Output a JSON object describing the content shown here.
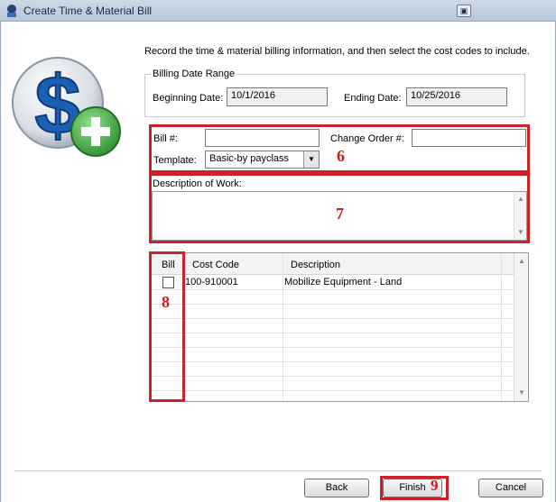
{
  "window": {
    "title": "Create Time & Material Bill"
  },
  "instructions": "Record the time & material billing information, and then select the cost codes to include.",
  "billing_range": {
    "group_label": "Billing Date Range",
    "beginning_label": "Beginning Date:",
    "beginning_value": "10/1/2016",
    "ending_label": "Ending Date:",
    "ending_value": "10/25/2016"
  },
  "bill_form": {
    "bill_label": "Bill #:",
    "bill_value": "",
    "change_order_label": "Change Order #:",
    "change_order_value": "",
    "template_label": "Template:",
    "template_value": "Basic-by payclass"
  },
  "description": {
    "label": "Description of Work:",
    "value": ""
  },
  "cost_table": {
    "columns": [
      "Bill",
      "Cost Code",
      "Description"
    ],
    "rows": [
      {
        "bill": false,
        "cost_code": "100-910001",
        "description": "Mobilize Equipment - Land"
      }
    ]
  },
  "annotations": {
    "6": "6",
    "7": "7",
    "8": "8",
    "9": "9"
  },
  "buttons": {
    "back": "Back",
    "finish": "Finish",
    "cancel": "Cancel"
  },
  "colors": {
    "annotation_red": "#d0202a",
    "logo_blue": "#1a5fb4",
    "plus_green": "#3aa63a"
  }
}
